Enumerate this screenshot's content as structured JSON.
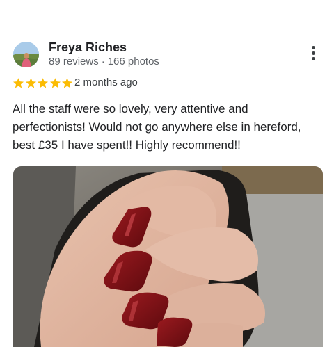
{
  "review": {
    "author": {
      "name": "Freya Riches",
      "reviews": "89 reviews",
      "separator": "·",
      "photos": "166 photos"
    },
    "rating": 5,
    "date": "2 months ago",
    "text_lines": [
      "All the staff were so lovely, very attentive and",
      "perfectionists! Would not go anywhere else in hereford,",
      "best £35 I have spent!! Highly recommend!!"
    ],
    "photo": {
      "subject": "hand with dark red square gel nails"
    }
  },
  "colors": {
    "star": "#fbbc04",
    "name": "#202124",
    "meta": "#5f6368",
    "nail": "#7a0f14"
  },
  "icons": {
    "more": "more-vert-icon",
    "star": "star-icon"
  }
}
